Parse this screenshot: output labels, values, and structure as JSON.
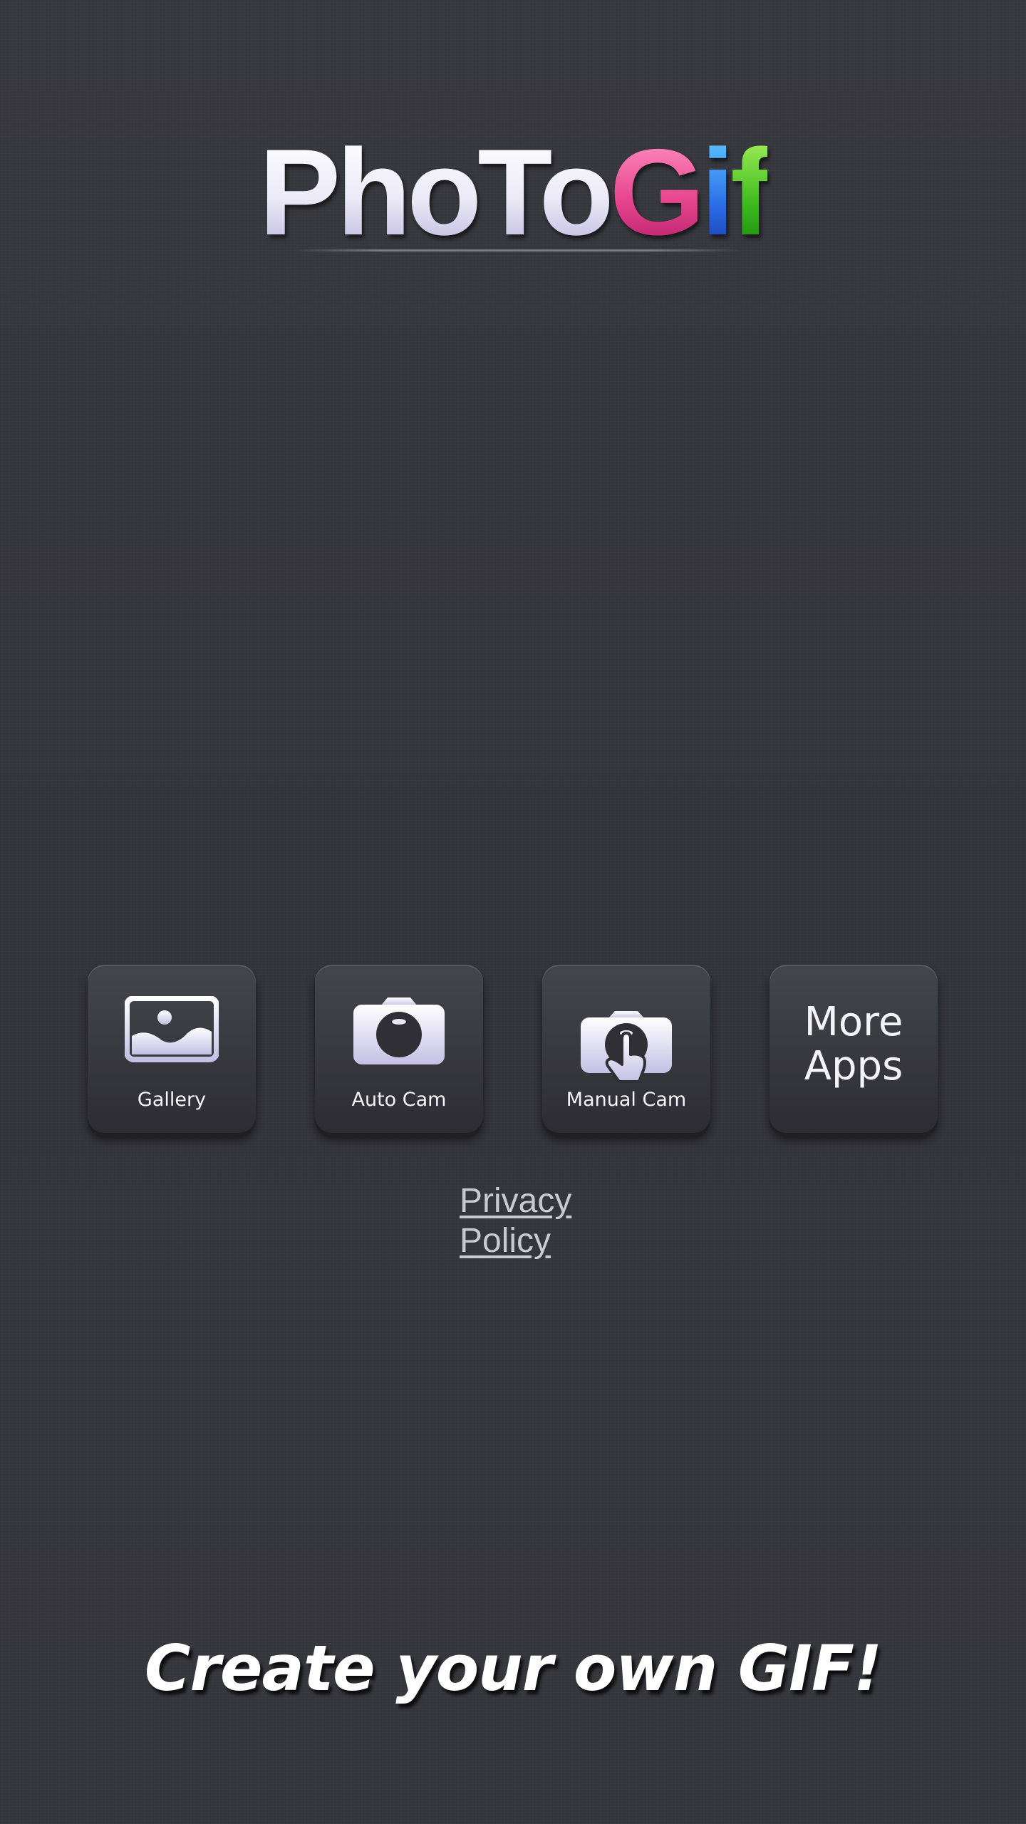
{
  "app": {
    "logo_parts": [
      {
        "text": "PhoTo",
        "style": "white"
      },
      {
        "text": "G",
        "style": "pink"
      },
      {
        "text": "i",
        "style": "blue"
      },
      {
        "text": "f",
        "style": "green"
      }
    ],
    "logo_colors": {
      "white_top": "#ffffff",
      "white_bottom": "#bebadf",
      "pink": "#e8478f",
      "blue": "#2c6ee6",
      "green": "#3dbb1e"
    }
  },
  "buttons": [
    {
      "id": "gallery",
      "label": "Gallery",
      "icon": "gallery-image-icon"
    },
    {
      "id": "auto_cam",
      "label": "Auto Cam",
      "icon": "camera-icon"
    },
    {
      "id": "manual_cam",
      "label": "Manual Cam",
      "icon": "camera-touch-icon"
    },
    {
      "id": "more_apps",
      "label": "More\nApps",
      "icon": ""
    }
  ],
  "privacy": {
    "label": "Privacy\nPolicy"
  },
  "tagline": "Create your own GIF!"
}
